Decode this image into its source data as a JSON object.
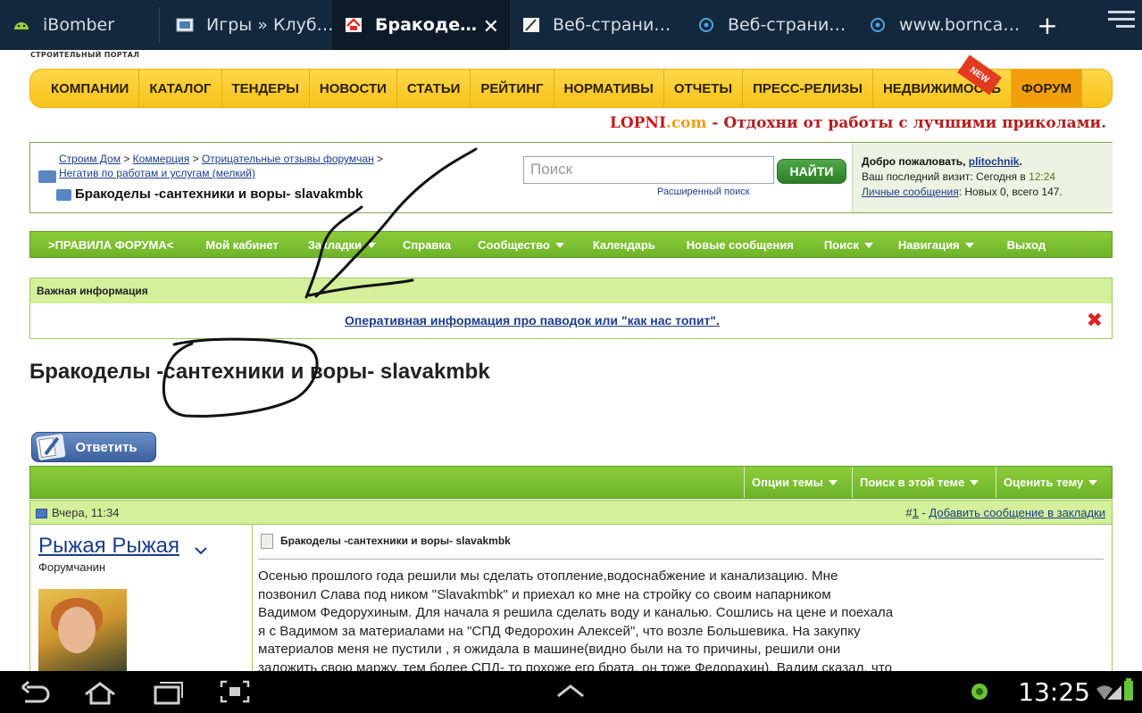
{
  "browser": {
    "tabs": [
      {
        "label": "iBomber",
        "icon": "android-icon",
        "active": false
      },
      {
        "label": "Игры » Клуб…",
        "icon": "image-icon",
        "active": false
      },
      {
        "label": "Бракоде…",
        "icon": "house-icon",
        "active": true
      },
      {
        "label": "Веб-страни…",
        "icon": "paper-icon",
        "active": false
      },
      {
        "label": "Веб-страни…",
        "icon": "globe-icon",
        "active": false
      },
      {
        "label": "www.bornca…",
        "icon": "globe-icon",
        "active": false
      }
    ],
    "close_glyph": "✕",
    "new_tab_glyph": "+"
  },
  "site": {
    "portal_label": "СТРОИТЕЛЬНЫЙ ПОРТАЛ",
    "topnav": [
      "КОМПАНИИ",
      "КАТАЛОГ",
      "ТЕНДЕРЫ",
      "НОВОСТИ",
      "СТАТЬИ",
      "РЕЙТИНГ",
      "НОРМАТИВЫ",
      "ОТЧЕТЫ",
      "ПРЕСС-РЕЛИЗЫ",
      "НЕДВИЖИМОСТЬ",
      "ФОРУМ"
    ],
    "new_badge": "NEW",
    "promo": {
      "logo_lo": "LO",
      "logo_pni": "PNI",
      "logo_com": ".com",
      "text": " - Отдохни от работы с лучшими приколами."
    }
  },
  "breadcrumb": {
    "items": [
      "Строим Дом",
      "Коммерция",
      "Отрицательные отзывы форумчан",
      "Негатив по работам и услугам (мелкий)"
    ],
    "separator": " > ",
    "current": "Бракоделы -сантехники и воры- slavakmbk"
  },
  "search": {
    "placeholder": "Поиск",
    "button": "НАЙТИ",
    "advanced": "Расширенный поиск"
  },
  "welcome": {
    "greeting": "Добро пожаловать, ",
    "username": "plitochnik",
    "last_visit_label": "Ваш последний визит: Сегодня в ",
    "last_visit_time": "12:24",
    "messages_link": "Личные сообщения",
    "messages_text": ": Новых 0, всего 147."
  },
  "forumnav": [
    {
      "label": ">ПРАВИЛА ФОРУМА<",
      "caret": false
    },
    {
      "label": "Мой кабинет",
      "caret": false
    },
    {
      "label": "Закладки",
      "caret": true
    },
    {
      "label": "Справка",
      "caret": false
    },
    {
      "label": "Сообщество",
      "caret": true
    },
    {
      "label": "Календарь",
      "caret": false
    },
    {
      "label": "Новые сообщения",
      "caret": false
    },
    {
      "label": "Поиск",
      "caret": true
    },
    {
      "label": "Навигация",
      "caret": true
    },
    {
      "label": "Выход",
      "caret": false
    }
  ],
  "notice": {
    "heading": "Важная информация",
    "link": "Оперативная информация про паводок или \"как нас топит\".",
    "close_glyph": "✖"
  },
  "thread": {
    "title": "Бракоделы -сантехники и воры- slavakmbk",
    "reply_button": "Ответить",
    "tools": [
      {
        "label": "Опции темы"
      },
      {
        "label": "Поиск в этой теме"
      },
      {
        "label": "Оценить тему"
      }
    ]
  },
  "post": {
    "date": "Вчера, 11:34",
    "number_prefix": "#",
    "number": "1",
    "bookmark_link": "Добавить сообщение в закладки",
    "author": "Рыжая Рыжая",
    "role": "Форумчанин",
    "title": "Бракоделы -сантехники и воры- slavakmbk",
    "lines": [
      "Осенью прошлого года решили мы сделать отопление,водоснабжение и канализацию. Мне",
      "позвонил Слава под ником \"Slavakmbk\" и приехал ко мне на стройку со своим напарником",
      "Вадимом Федорухиным. Для начала я решила сделать воду и каналью. Сошлись на цене и поехала",
      "я с Вадимом за материалами на \"СПД Федорохин Алексей\", что возле Большевика. На закупку",
      "материалов меня не пустили , я ожидала в машине(видно были на то причины, решили они",
      "заложить свою маржу, тем более СПД- то похоже его брата, он тоже Федорахин). Вадим сказал, что"
    ]
  },
  "system": {
    "clock": "13:25"
  }
}
